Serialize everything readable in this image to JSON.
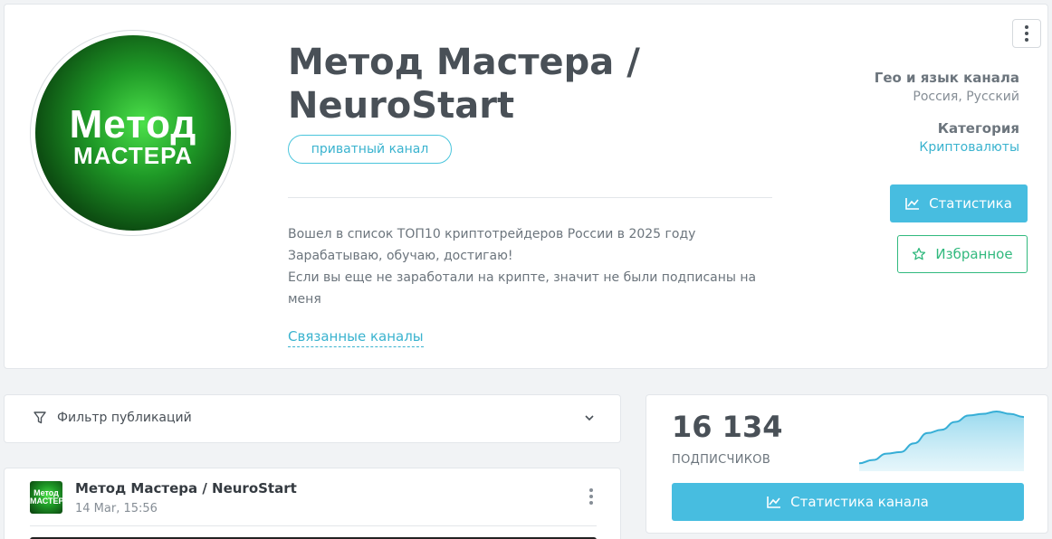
{
  "profile": {
    "avatar": {
      "line1": "Метод",
      "line2": "МАСТЕРА"
    },
    "title": "Метод Мастера / NeuroStart",
    "badge": "приватный канал",
    "description": [
      "Вошел в список ТОП10 криптотрейдеров России в 2025 году",
      "Зарабатываю, обучаю, достигаю!",
      "Если вы еще не заработали на крипте, значит не были подписаны на меня"
    ],
    "related_link": "Связанные каналы",
    "geo_label": "Гео и язык канала",
    "geo_value": "Россия, Русский",
    "category_label": "Категория",
    "category_value": "Криптовалюты",
    "stats_button": "Статистика",
    "favorite_button": "Избранное",
    "menu_icon": "kebab-vertical-icon"
  },
  "filter": {
    "label": "Фильтр публикаций",
    "icon": "funnel-icon",
    "chevron_icon": "chevron-down-icon"
  },
  "post": {
    "author": "Метод Мастера / NeuroStart",
    "date": "14 Mar, 15:56",
    "avatar_text": "Метод МАСТЕРА"
  },
  "subscribers": {
    "count": "16 134",
    "label": "ПОДПИСЧИКОВ",
    "button": "Статистика канала",
    "sparkline": [
      10,
      14,
      22,
      24,
      35,
      48,
      52,
      62,
      70,
      72,
      75,
      72,
      68
    ]
  },
  "colors": {
    "accent": "#47bde0",
    "link": "#3ab3cf",
    "favorite": "#31b97e"
  }
}
